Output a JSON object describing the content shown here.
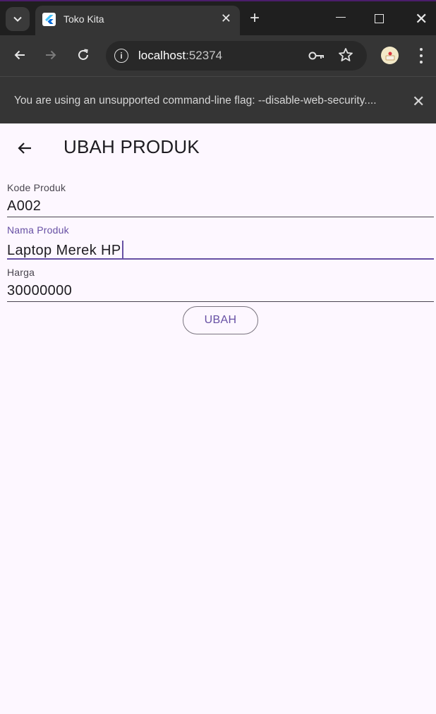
{
  "browser": {
    "tab_title": "Toko Kita",
    "address_host": "localhost",
    "address_port": ":52374",
    "infobar_text": "You are using an unsupported command-line flag: --disable-web-security....",
    "accent_color": "#4b1d6b"
  },
  "app": {
    "page_title": "UBAH PRODUK",
    "fields": [
      {
        "label": "Kode Produk",
        "value": "A002"
      },
      {
        "label": "Nama Produk",
        "value": "Laptop Merek HP",
        "focused": true
      },
      {
        "label": "Harga",
        "value": "30000000"
      }
    ],
    "submit_label": "UBAH",
    "primary_color": "#6750a4",
    "background_color": "#fdf7ff"
  }
}
